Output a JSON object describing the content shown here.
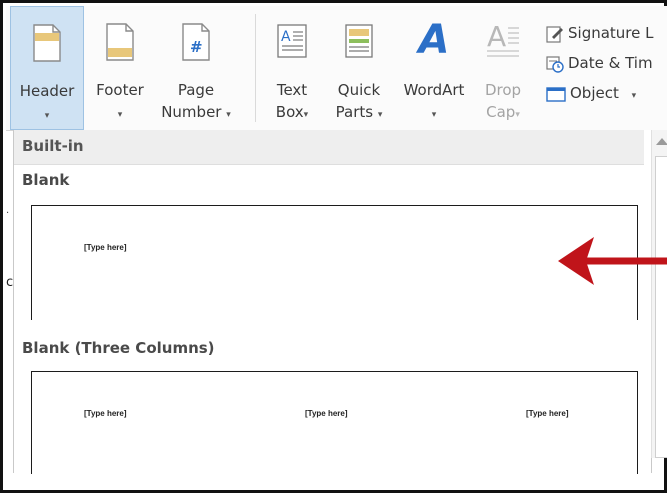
{
  "ribbon": {
    "header": {
      "line1": "Header",
      "caret": "▾",
      "icon": "header-icon"
    },
    "footer": {
      "line1": "Footer",
      "caret": "▾",
      "icon": "footer-icon"
    },
    "page_number": {
      "line1": "Page",
      "line2": "Number",
      "caret": "▾",
      "icon": "page-number-icon",
      "glyph": "#"
    },
    "text_box": {
      "line1": "Text",
      "line2": "Box",
      "caret": "▾",
      "icon": "text-box-icon"
    },
    "quick_parts": {
      "line1": "Quick",
      "line2": "Parts",
      "caret": "▾",
      "icon": "quick-parts-icon"
    },
    "wordart": {
      "line1": "WordArt",
      "caret": "▾",
      "icon": "wordart-icon",
      "glyph": "A"
    },
    "drop_cap": {
      "line1": "Drop",
      "line2": "Cap",
      "caret": "▾",
      "icon": "drop-cap-icon",
      "glyph": "A"
    },
    "signature_line": {
      "label": "Signature L",
      "icon": "signature-line-icon"
    },
    "date_time": {
      "label": "Date & Tim",
      "icon": "date-time-icon"
    },
    "object": {
      "label": "Object",
      "caret": "▾",
      "icon": "object-icon"
    }
  },
  "dropdown": {
    "section": "Built-in",
    "galleries": [
      {
        "title": "Blank",
        "placeholders": [
          "[Type here]"
        ]
      },
      {
        "title": "Blank (Three Columns)",
        "placeholders": [
          "[Type here]",
          "[Type here]",
          "[Type here]"
        ]
      }
    ]
  },
  "colors": {
    "accent_selected": "#cfe2f3",
    "annotation_arrow": "#c0141a",
    "wordart_blue": "#2b6fc7"
  }
}
